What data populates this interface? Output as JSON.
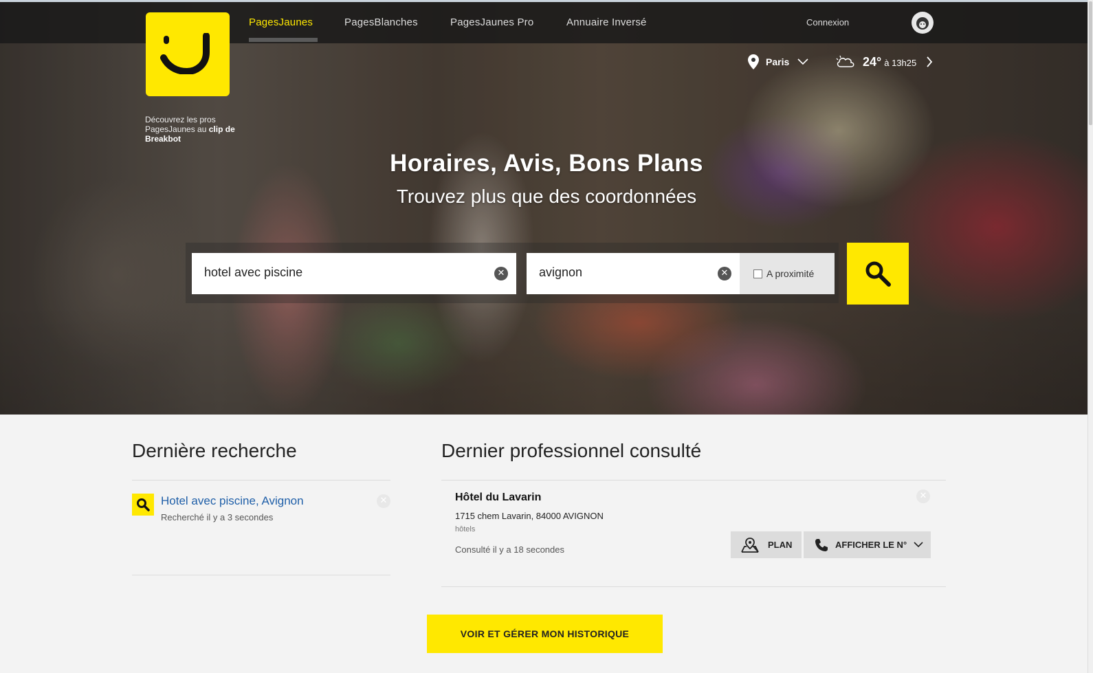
{
  "nav": {
    "items": [
      "PagesJaunes",
      "PagesBlanches",
      "PagesJaunes Pro",
      "Annuaire Inversé"
    ],
    "connexion": "Connexion"
  },
  "promo": {
    "text": "Découvrez les pros PagesJaunes au ",
    "bold": "clip de Breakbot"
  },
  "location": {
    "city": "Paris"
  },
  "weather": {
    "temp": "24°",
    "time": "à 13h25"
  },
  "hero": {
    "headline": "Horaires, Avis, Bons Plans",
    "subline": "Trouvez plus que des coordonnées"
  },
  "search": {
    "what": "hotel avec piscine",
    "where": "avignon",
    "proximite_label": "A proximité"
  },
  "last_search": {
    "title": "Dernière recherche",
    "link": "Hotel avec piscine, Avignon",
    "time": "Recherché il y a 3 secondes"
  },
  "last_pro": {
    "title": "Dernier professionnel consulté",
    "name": "Hôtel du Lavarin",
    "address": "1715 chem Lavarin, 84000 AVIGNON",
    "category": "hôtels",
    "time": "Consulté il y a 18 secondes",
    "plan_label": "PLAN",
    "phone_label": "AFFICHER LE N°"
  },
  "history_button": "VOIR ET GÉRER MON HISTORIQUE",
  "colors": {
    "brand_yellow": "#ffe800",
    "link_blue": "#1f5fa8"
  }
}
